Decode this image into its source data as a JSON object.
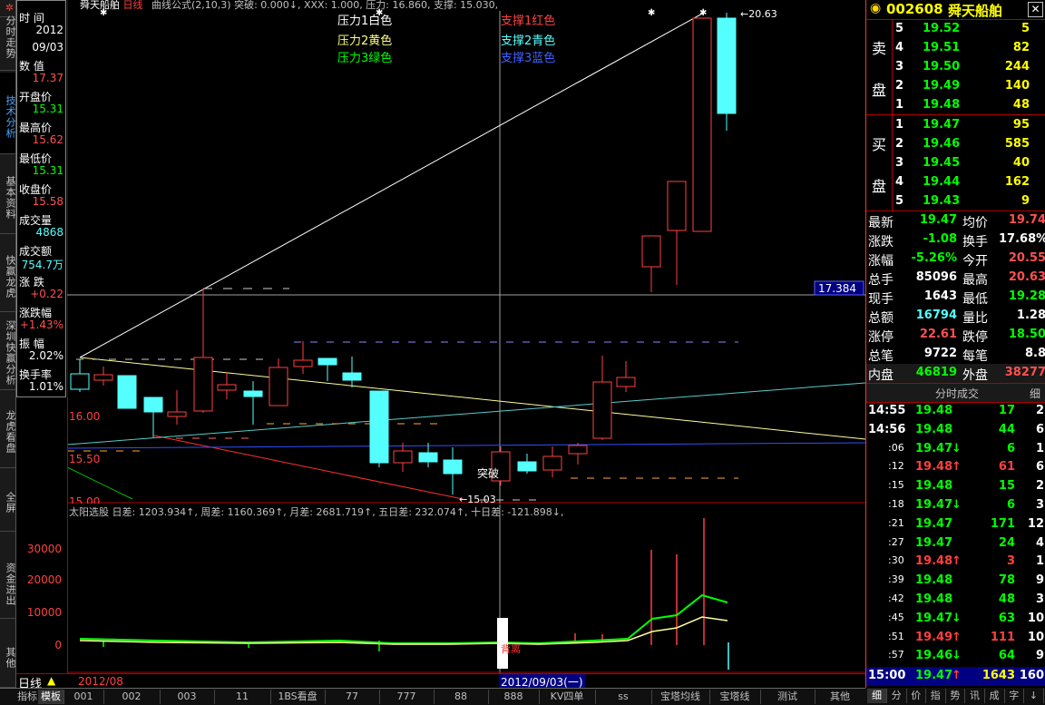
{
  "left_tabs": [
    "分时走势",
    "技术分析",
    "基本资料",
    "快赢龙虎",
    "深圳快赢分析",
    "龙虎看盘",
    "全屏",
    "资金进出",
    "其他"
  ],
  "info_panel": [
    {
      "label": "时  间",
      "value": "2012",
      "color": "#ffffff"
    },
    {
      "label": "",
      "value": "09/03",
      "color": "#ffffff"
    },
    {
      "label": "数  值",
      "value": "17.37",
      "color": "#ff5050"
    },
    {
      "label": "开盘价",
      "value": "15.31",
      "color": "#00ff00"
    },
    {
      "label": "最高价",
      "value": "15.62",
      "color": "#ff5050"
    },
    {
      "label": "最低价",
      "value": "15.31",
      "color": "#00ff00"
    },
    {
      "label": "收盘价",
      "value": "15.58",
      "color": "#ff5050"
    },
    {
      "label": "成交量",
      "value": "4868",
      "color": "#55ffff"
    },
    {
      "label": "成交额",
      "value": "754.7万",
      "color": "#55ffff"
    },
    {
      "label": "涨  跌",
      "value": "+0.22",
      "color": "#ff5050"
    },
    {
      "label": "涨跌幅",
      "value": "+1.43%",
      "color": "#ff5050"
    },
    {
      "label": "振  幅",
      "value": "2.02%",
      "color": "#ffffff"
    },
    {
      "label": "换手率",
      "value": "1.01%",
      "color": "#ffffff"
    }
  ],
  "chart_header": {
    "name": "舜天船舶",
    "period": "日线",
    "formula": "曲线公式(2,10,3) 突破: 0.000↓, XXX: 1.000, 压力: 16.860, 支撑: 15.030,"
  },
  "legend": [
    {
      "text": "压力1白色",
      "color": "#ffffff"
    },
    {
      "text": "压力2黄色",
      "color": "#ffff80"
    },
    {
      "text": "压力3绿色",
      "color": "#00ff00"
    },
    {
      "text": "支撑1红色",
      "color": "#ff4040"
    },
    {
      "text": "支撑2青色",
      "color": "#55ffff"
    },
    {
      "text": "支撑3蓝色",
      "color": "#4060ff"
    }
  ],
  "price_labels": [
    "16.00",
    "15.50",
    "15.00"
  ],
  "annotations": {
    "high": "20.63",
    "low": "15.03",
    "breakout": "突破",
    "cursor_price": "17.384",
    "pressure": "压力"
  },
  "vol_header": "太阳选股  日差: 1203.934↑, 周差: 1160.369↑, 月差: 2681.719↑, 五日差: 232.074↑, 十日差: -121.898↓,",
  "vol_labels": [
    "30000",
    "20000",
    "10000",
    "0"
  ],
  "vol_note": "背离",
  "bottom_left": {
    "period": "日线",
    "date": "2012/08",
    "cursor_date": "2012/09/03(一)"
  },
  "right_panel": {
    "code": "002608",
    "name": "舜天船舶",
    "sell_label": [
      "卖",
      "盘"
    ],
    "buy_label": [
      "买",
      "盘"
    ],
    "sell": [
      {
        "lvl": "5",
        "price": "19.52",
        "vol": "5"
      },
      {
        "lvl": "4",
        "price": "19.51",
        "vol": "82"
      },
      {
        "lvl": "3",
        "price": "19.50",
        "vol": "244"
      },
      {
        "lvl": "2",
        "price": "19.49",
        "vol": "140"
      },
      {
        "lvl": "1",
        "price": "19.48",
        "vol": "48"
      }
    ],
    "buy": [
      {
        "lvl": "1",
        "price": "19.47",
        "vol": "95"
      },
      {
        "lvl": "2",
        "price": "19.46",
        "vol": "585"
      },
      {
        "lvl": "3",
        "price": "19.45",
        "vol": "40"
      },
      {
        "lvl": "4",
        "price": "19.44",
        "vol": "162"
      },
      {
        "lvl": "5",
        "price": "19.43",
        "vol": "9"
      }
    ],
    "stats": [
      {
        "l1": "最新",
        "v1": "19.47",
        "c1": "#00ff00",
        "l2": "均价",
        "v2": "19.74",
        "c2": "#ff5050"
      },
      {
        "l1": "涨跌",
        "v1": "-1.08",
        "c1": "#00ff00",
        "l2": "换手",
        "v2": "17.68%",
        "c2": "#ffffff"
      },
      {
        "l1": "涨幅",
        "v1": "-5.26%",
        "c1": "#00ff00",
        "l2": "今开",
        "v2": "20.55",
        "c2": "#ff5050"
      },
      {
        "l1": "总手",
        "v1": "85096",
        "c1": "#ffffff",
        "l2": "最高",
        "v2": "20.63",
        "c2": "#ff5050"
      },
      {
        "l1": "现手",
        "v1": "1643",
        "c1": "#ffffff",
        "l2": "最低",
        "v2": "19.28",
        "c2": "#00ff00"
      },
      {
        "l1": "总额",
        "v1": "16794",
        "c1": "#55ffff",
        "l2": "量比",
        "v2": "1.28",
        "c2": "#ffffff"
      },
      {
        "l1": "涨停",
        "v1": "22.61",
        "c1": "#ff5050",
        "l2": "跌停",
        "v2": "18.50",
        "c2": "#00ff00"
      },
      {
        "l1": "总笔",
        "v1": "9722",
        "c1": "#ffffff",
        "l2": "每笔",
        "v2": "8.8",
        "c2": "#ffffff"
      },
      {
        "l1": "内盘",
        "v1": "46819",
        "c1": "#00ff00",
        "l2": "外盘",
        "v2": "38277",
        "c2": "#ff5050"
      }
    ],
    "ticks_title": "分时成交",
    "ticks_btn": "细",
    "ticks": [
      {
        "t": "14:55",
        "p": "19.48",
        "a": "",
        "v": "17",
        "n": "2"
      },
      {
        "t": "14:56",
        "p": "19.48",
        "a": "",
        "v": "44",
        "n": "6"
      },
      {
        "t": ":06",
        "p": "19.47",
        "a": "↓",
        "v": "6",
        "n": "1"
      },
      {
        "t": ":12",
        "p": "19.48",
        "a": "↑",
        "v": "61",
        "n": "6"
      },
      {
        "t": ":15",
        "p": "19.48",
        "a": "",
        "v": "15",
        "n": "2"
      },
      {
        "t": ":18",
        "p": "19.47",
        "a": "↓",
        "v": "6",
        "n": "3"
      },
      {
        "t": ":21",
        "p": "19.47",
        "a": "",
        "v": "171",
        "n": "12"
      },
      {
        "t": ":27",
        "p": "19.47",
        "a": "",
        "v": "24",
        "n": "4"
      },
      {
        "t": ":30",
        "p": "19.48",
        "a": "↑",
        "v": "3",
        "n": "1"
      },
      {
        "t": ":39",
        "p": "19.48",
        "a": "",
        "v": "78",
        "n": "9"
      },
      {
        "t": ":42",
        "p": "19.48",
        "a": "",
        "v": "48",
        "n": "3"
      },
      {
        "t": ":45",
        "p": "19.47",
        "a": "↓",
        "v": "63",
        "n": "10"
      },
      {
        "t": ":51",
        "p": "19.49",
        "a": "↑",
        "v": "111",
        "n": "10"
      },
      {
        "t": ":57",
        "p": "19.46",
        "a": "↓",
        "v": "64",
        "n": "9"
      }
    ],
    "last_tick": {
      "t": "15:00",
      "p": "19.47",
      "a": "↑",
      "v": "1643",
      "n": "160"
    },
    "bottom_tabs": [
      "细",
      "分",
      "价",
      "指",
      "势",
      "讯",
      "成",
      "字",
      "↓"
    ]
  },
  "bottom_tabs": [
    "指标",
    "模板",
    "001",
    "002",
    "003",
    "11",
    "1BS看盘",
    "77",
    "777",
    "88",
    "888",
    "KV四单",
    "ss",
    "宝塔均线",
    "宝塔线",
    "测试",
    "其他"
  ]
}
